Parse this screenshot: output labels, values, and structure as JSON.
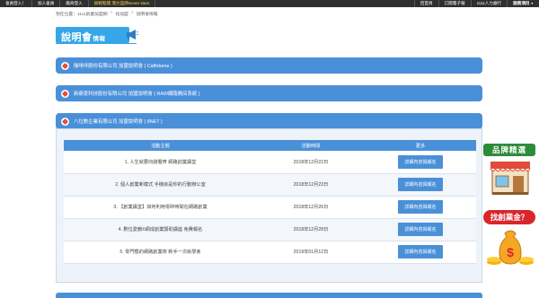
{
  "topbar": {
    "left": [
      "會員登入！",
      "加入會員",
      "廠商登入"
    ],
    "promo": "搞輕鬆開 潛力品牌seven stars",
    "right": [
      "回首頁",
      "訂閱電子報",
      "1111人力銀行",
      "服務項目"
    ]
  },
  "breadcrumb": [
    "現在位置：1111創業加盟網",
    "找加盟",
    "說明會情報"
  ],
  "section": {
    "title": "說明會",
    "subtitle": "情報"
  },
  "accordions": [
    "咖啡伴股份有限公司 加盟說明會 ( Caffebene )",
    "新鼎景科技股份有限公司 加盟說明會 ( RAW網路開店系統 )",
    "八位數企業有限公司 加盟說明會 ( 8NET )"
  ],
  "table": {
    "headers": [
      "活動主題",
      "活動時間",
      "更多"
    ],
    "rows": [
      {
        "topic": "1. 人生就要向錢看齊 網路創業講堂",
        "date": "2018年12月22日",
        "action": "詳細內容與報名"
      },
      {
        "topic": "2. 個人創業新模式 手機就是你的行動辦公室",
        "date": "2018年12月23日",
        "action": "詳細內容與報名"
      },
      {
        "topic": "3. 【創業講堂】如何利用零碎時間在網路創業",
        "date": "2018年12月26日",
        "action": "詳細內容與報名"
      },
      {
        "topic": "4. 數位愛鎖X網成創業贊助講座 免費報名",
        "date": "2018年12月28日",
        "action": "詳細內容與報名"
      },
      {
        "topic": "5. 零門檻的網路創業術 新手一次就學會",
        "date": "2019年01月12日",
        "action": "詳細內容與報名"
      }
    ]
  },
  "ads": {
    "brand": "品牌精選",
    "money": "找創業金？"
  }
}
